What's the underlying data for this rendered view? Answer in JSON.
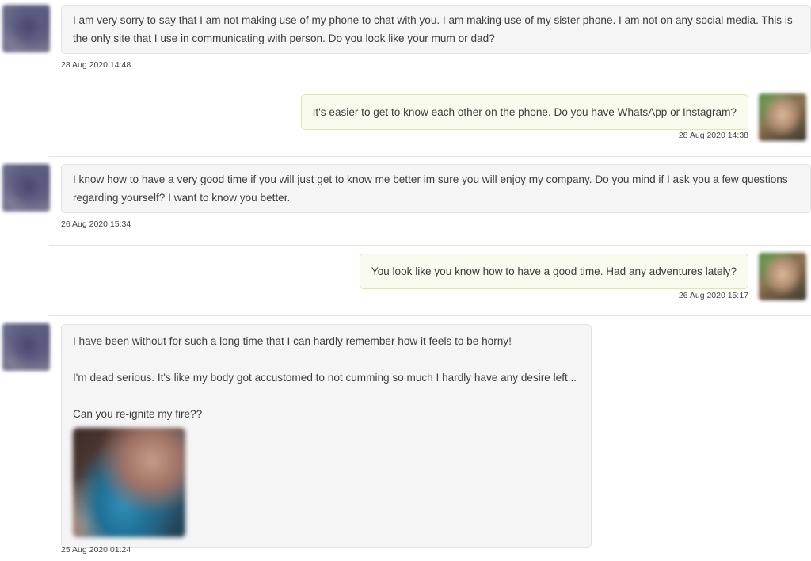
{
  "messages": [
    {
      "direction": "incoming",
      "text": "I am very sorry to say that I am not making use of my phone to chat with you. I am making use of my sister phone. I am not on any social media. This is the only site that I use in communicating with person. Do you look like your mum or dad?",
      "time": "28 Aug 2020 14:48"
    },
    {
      "direction": "outgoing",
      "text": "It's easier to get to know each other on the phone. Do you have WhatsApp or Instagram?",
      "time": "28 Aug 2020 14:38"
    },
    {
      "direction": "incoming",
      "text": "I know how to have a very good time if you will just get to know me better im sure you will enjoy my company. Do you mind if I ask you a few questions regarding yourself? I want to know you better.",
      "time": "26 Aug 2020 15:34"
    },
    {
      "direction": "outgoing",
      "text": "You look like you know how to have a good time. Had any adventures lately?",
      "time": "26 Aug 2020 15:17"
    },
    {
      "direction": "incoming",
      "paragraphs": [
        "I have been without for such a long time that I can hardly remember how it feels to be horny!",
        "I'm dead serious. It's like my body got accustomed to not cumming so much I hardly have any desire left...",
        "Can you re-ignite my fire??"
      ],
      "has_photo": true,
      "time": "25 Aug 2020 01:24"
    }
  ]
}
